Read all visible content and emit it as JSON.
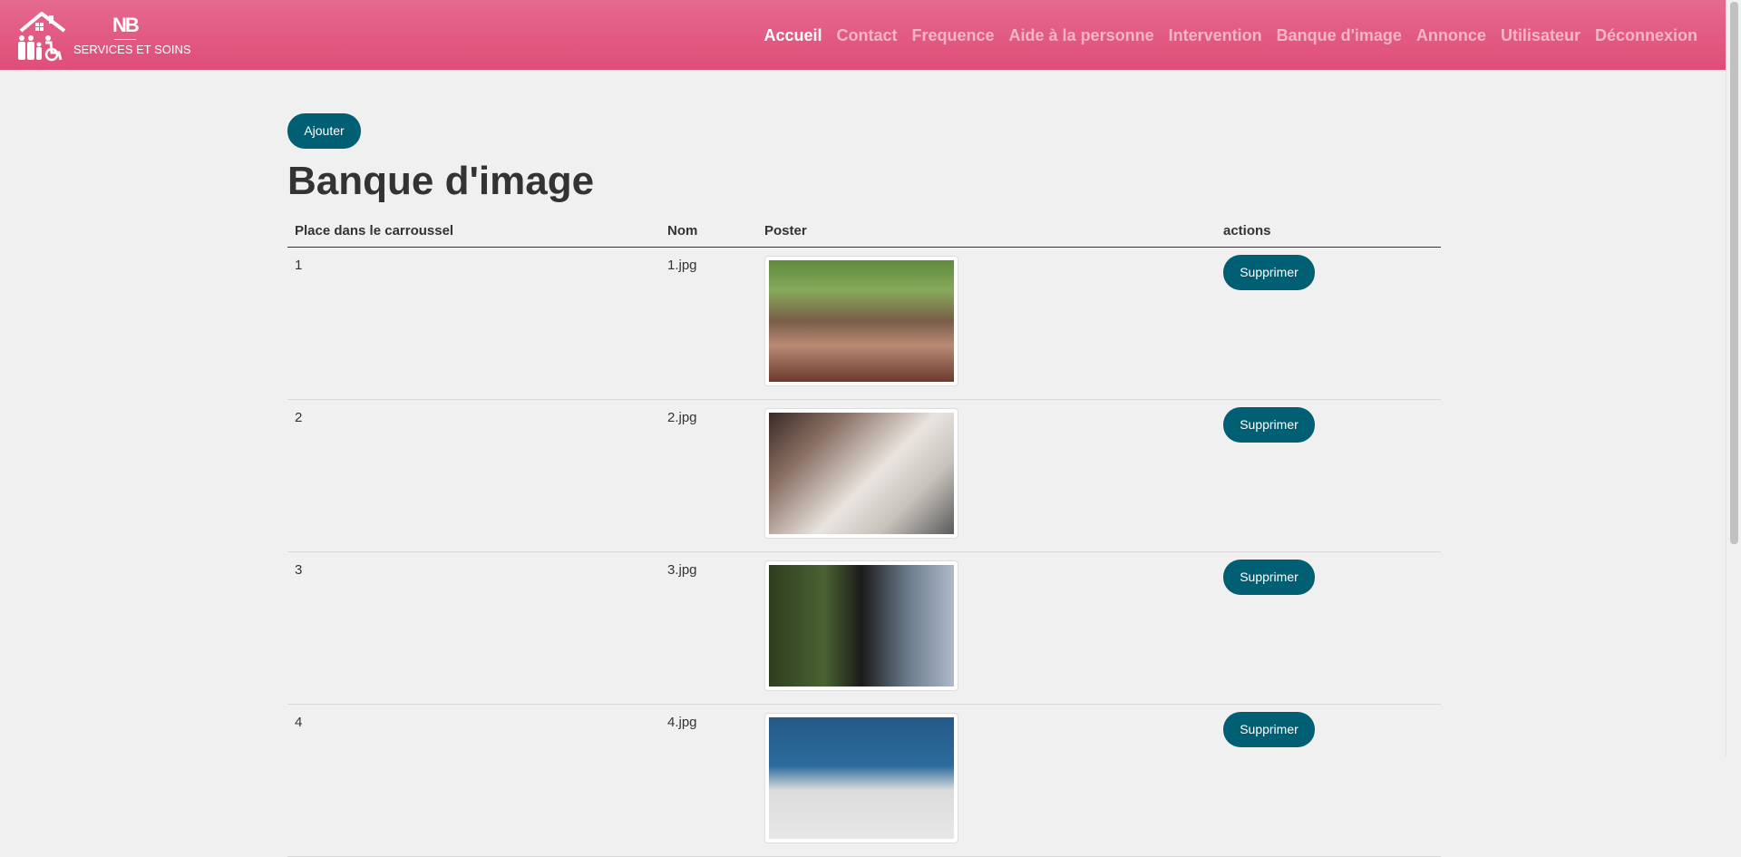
{
  "brand": {
    "logo_mark": "NB",
    "logo_sub": "SERVICES ET SOINS",
    "icon": "house-family-icon"
  },
  "nav": {
    "items": [
      {
        "label": "Accueil",
        "active": true
      },
      {
        "label": "Contact",
        "active": false
      },
      {
        "label": "Frequence",
        "active": false
      },
      {
        "label": "Aide à la personne",
        "active": false
      },
      {
        "label": "Intervention",
        "active": false
      },
      {
        "label": "Banque d'image",
        "active": false
      },
      {
        "label": "Annonce",
        "active": false
      },
      {
        "label": "Utilisateur",
        "active": false
      },
      {
        "label": "Déconnexion",
        "active": false
      }
    ]
  },
  "main": {
    "add_button_label": "Ajouter",
    "title": "Banque d'image",
    "table": {
      "headers": {
        "place": "Place dans le carroussel",
        "nom": "Nom",
        "poster": "Poster",
        "actions": "actions"
      },
      "rows": [
        {
          "place": "1",
          "nom": "1.jpg",
          "delete_label": "Supprimer"
        },
        {
          "place": "2",
          "nom": "2.jpg",
          "delete_label": "Supprimer"
        },
        {
          "place": "3",
          "nom": "3.jpg",
          "delete_label": "Supprimer"
        },
        {
          "place": "4",
          "nom": "4.jpg",
          "delete_label": "Supprimer"
        }
      ]
    }
  },
  "colors": {
    "navbar_top": "#e5698f",
    "navbar_bottom": "#df4d77",
    "button": "#005f73",
    "background": "#f0f0f0"
  }
}
